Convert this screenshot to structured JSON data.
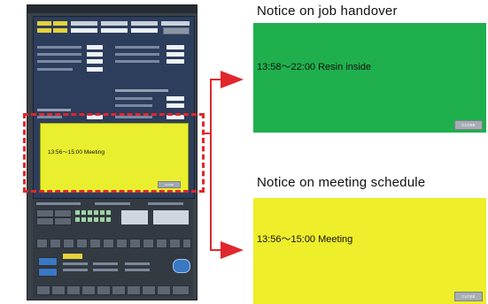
{
  "notices": [
    {
      "heading": "Notice on job handover",
      "message": "13:58〜22:00 Resin inside",
      "close_label": "CLOSE",
      "background": "#1fb04d"
    },
    {
      "heading": "Notice on meeting schedule",
      "message": "13:56〜15:00 Meeting",
      "close_label": "CLOSE",
      "background": "#eeee2a"
    }
  ],
  "hmi_popup": {
    "message": "13:56〜15:00 Meeting",
    "close_label": "CLOSE",
    "background": "#e9ef2f"
  },
  "colors": {
    "highlight": "#e0272b",
    "panel": "#3b4149"
  }
}
